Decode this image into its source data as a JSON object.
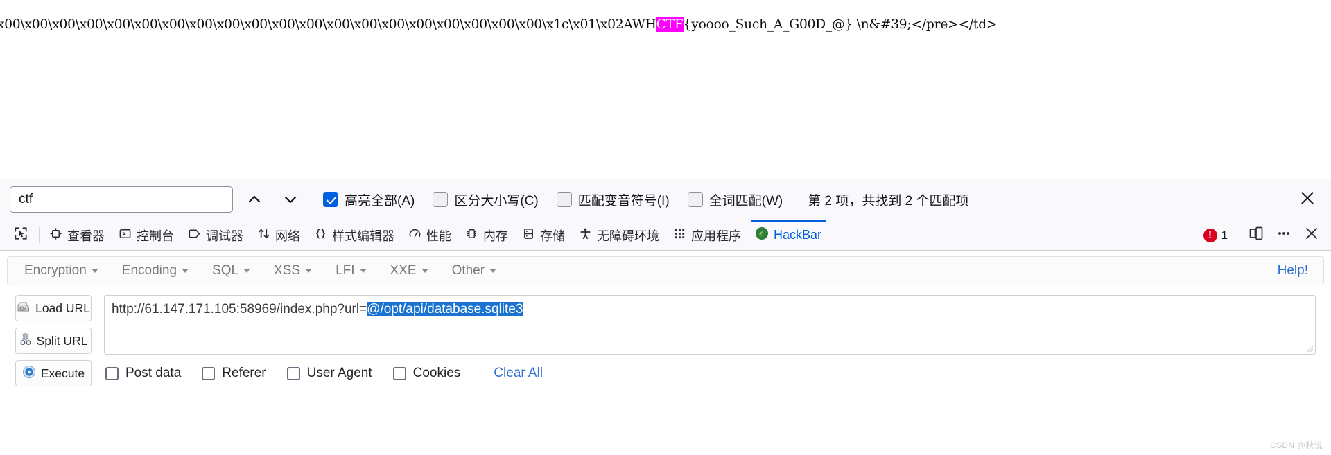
{
  "page": {
    "dump_prefix": "x00\\x00\\x00\\x00\\x00\\x00\\x00\\x00\\x00\\x00\\x00\\x00\\x00\\x00\\x00\\x00\\x00\\x00\\x00\\x00\\x1c\\x01\\x02AWH",
    "dump_highlight": "CTF",
    "dump_suffix": "{yoooo_Such_A_G00D_@} \\n&#39;</pre></td>"
  },
  "find_bar": {
    "query": "ctf",
    "placeholder": "",
    "prev_icon": "chevron-up-icon",
    "next_icon": "chevron-down-icon",
    "highlight_all_label": "高亮全部(A)",
    "highlight_all_checked": true,
    "match_case_label": "区分大小写(C)",
    "match_case_checked": false,
    "match_diacritics_label": "匹配变音符号(I)",
    "match_diacritics_checked": false,
    "whole_words_label": "全词匹配(W)",
    "whole_words_checked": false,
    "status": "第 2 项，共找到 2 个匹配项",
    "close_icon": "close-icon"
  },
  "devtools": {
    "picker_icon": "element-picker-icon",
    "tabs": [
      {
        "label": "查看器",
        "icon": "inspector-icon",
        "active": false
      },
      {
        "label": "控制台",
        "icon": "console-icon",
        "active": false
      },
      {
        "label": "调试器",
        "icon": "debugger-icon",
        "active": false
      },
      {
        "label": "网络",
        "icon": "network-icon",
        "active": false
      },
      {
        "label": "样式编辑器",
        "icon": "style-editor-icon",
        "active": false
      },
      {
        "label": "性能",
        "icon": "performance-icon",
        "active": false
      },
      {
        "label": "内存",
        "icon": "memory-icon",
        "active": false
      },
      {
        "label": "存储",
        "icon": "storage-icon",
        "active": false
      },
      {
        "label": "无障碍环境",
        "icon": "accessibility-icon",
        "active": false
      },
      {
        "label": "应用程序",
        "icon": "application-icon",
        "active": false
      },
      {
        "label": "HackBar",
        "icon": "hackbar-icon",
        "active": true
      }
    ],
    "error_count": "1",
    "responsive_icon": "responsive-design-mode-icon",
    "meatball_icon": "more-options-icon",
    "close_icon": "close-devtools-icon",
    "accent_color": "#0060df",
    "error_color": "#d70022"
  },
  "hackbar": {
    "menus": [
      {
        "label": "Encryption"
      },
      {
        "label": "Encoding"
      },
      {
        "label": "SQL"
      },
      {
        "label": "XSS"
      },
      {
        "label": "LFI"
      },
      {
        "label": "XXE"
      },
      {
        "label": "Other"
      }
    ],
    "help_label": "Help!",
    "buttons": [
      {
        "label": "Load URL",
        "icon": "load-url-icon"
      },
      {
        "label": "Split URL",
        "icon": "split-url-icon"
      },
      {
        "label": "Execute",
        "icon": "execute-icon"
      }
    ],
    "url_prefix": "http://61.147.171.105:58969/index.php?url=",
    "url_selected": "@/opt/api/database.sqlite3",
    "options": [
      {
        "label": "Post data",
        "checked": false
      },
      {
        "label": "Referer",
        "checked": false
      },
      {
        "label": "User Agent",
        "checked": false
      },
      {
        "label": "Cookies",
        "checked": false
      }
    ],
    "clear_all_label": "Clear All",
    "link_color": "#2f6fd0",
    "selection_color": "#1a73cf"
  },
  "watermark": "CSDN @秋说"
}
